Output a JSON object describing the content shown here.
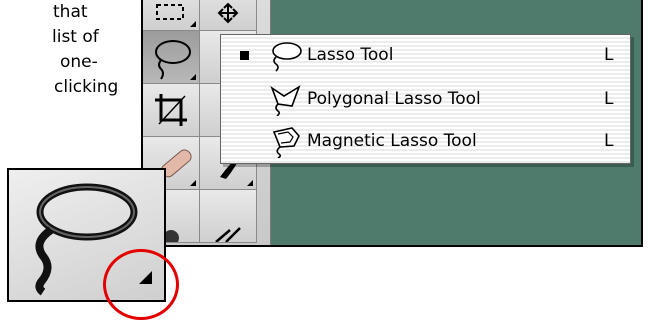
{
  "intro_text": {
    "lines": [
      "that",
      " list of",
      "one-",
      "clicking"
    ]
  },
  "flyout_menu": {
    "items": [
      {
        "label": "Lasso Tool",
        "shortcut": "L",
        "selected": true,
        "icon": "lasso-icon"
      },
      {
        "label": "Polygonal Lasso Tool",
        "shortcut": "L",
        "selected": false,
        "icon": "polygonal-lasso-icon"
      },
      {
        "label": "Magnetic Lasso Tool",
        "shortcut": "L",
        "selected": false,
        "icon": "magnetic-lasso-icon"
      }
    ]
  },
  "toolbox": {
    "tools": [
      "marquee-icon",
      "move-icon",
      "lasso-icon",
      "crop-icon",
      "healing-brush-icon",
      "brush-icon",
      "clone-stamp-icon",
      "history-brush-icon"
    ]
  },
  "colors": {
    "canvas_background": "#4f7b6d",
    "highlight_circle": "#e30000"
  }
}
